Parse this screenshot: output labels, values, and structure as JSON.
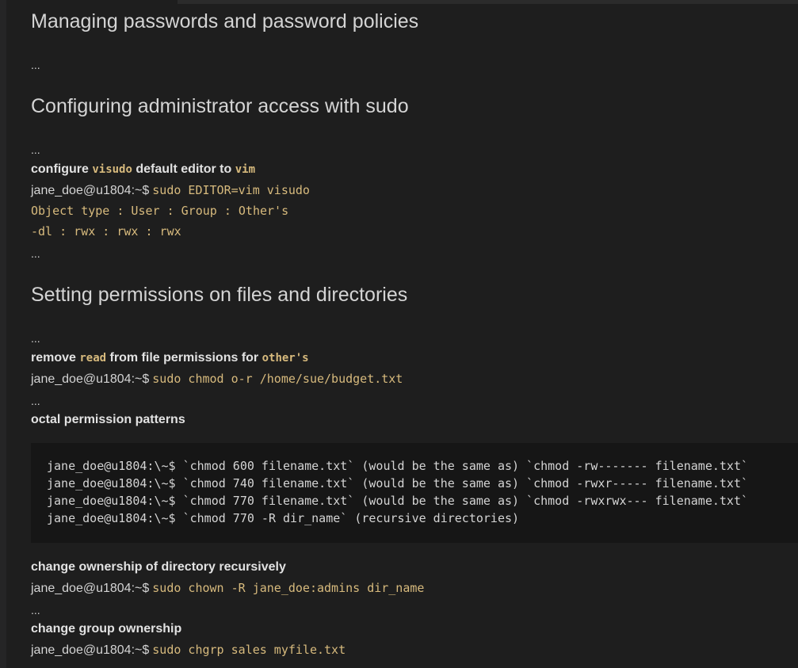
{
  "sections": {
    "passwords": {
      "heading": "Managing passwords and password policies",
      "ellipsis": "..."
    },
    "sudo": {
      "heading": "Configuring administrator access with sudo",
      "ellipsis_top": "...",
      "note": {
        "pre": "configure",
        "kw1": "visudo",
        "mid": "default editor to",
        "kw2": "vim"
      },
      "command": {
        "prompt": "jane_doe@u1804:~$",
        "text": "sudo EDITOR=vim visudo"
      },
      "output": [
        "Object type : User : Group : Other's",
        "-dl : rwx : rwx : rwx"
      ],
      "ellipsis_bottom": "..."
    },
    "permissions": {
      "heading": "Setting permissions on files and directories",
      "ellipsis_top": "...",
      "note": {
        "pre": "remove",
        "kw1": "read",
        "mid": "from file permissions for",
        "kw2": "other's"
      },
      "command": {
        "prompt": "jane_doe@u1804:~$",
        "text": "sudo chmod o-r /home/sue/budget.txt"
      },
      "ellipsis_mid": "...",
      "octal_heading": "octal permission patterns",
      "code_lines": [
        "jane_doe@u1804:\\~$ `chmod 600 filename.txt` (would be the same as) `chmod -rw------- filename.txt`",
        "jane_doe@u1804:\\~$ `chmod 740 filename.txt` (would be the same as) `chmod -rwxr----- filename.txt`",
        "jane_doe@u1804:\\~$ `chmod 770 filename.txt` (would be the same as) `chmod -rwxrwx--- filename.txt`",
        "jane_doe@u1804:\\~$ `chmod 770 -R dir_name` (recursive directories)"
      ],
      "chown_heading": "change ownership of directory recursively",
      "chown_command": {
        "prompt": "jane_doe@u1804:~$",
        "text": "sudo chown -R jane_doe:admins dir_name"
      },
      "ellipsis_after_chown": "...",
      "chgrp_heading": "change group ownership",
      "chgrp_command": {
        "prompt": "jane_doe@u1804:~$",
        "text": "sudo chgrp sales myfile.txt"
      }
    }
  },
  "colors": {
    "background": "#1e1e1e",
    "text": "#d4d4d4",
    "code_accent": "#d7ba7d",
    "code_block_bg": "#161616"
  }
}
